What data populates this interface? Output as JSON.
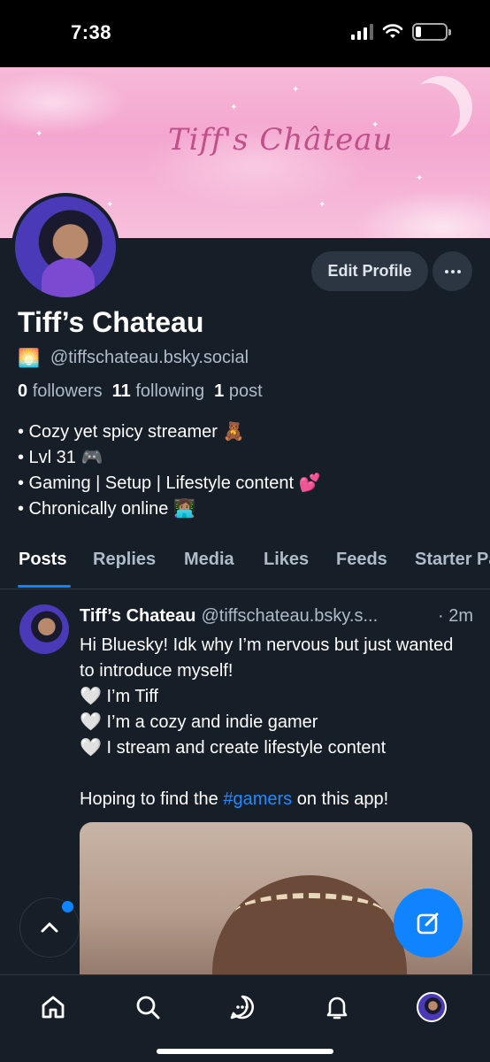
{
  "status_bar": {
    "time": "7:38"
  },
  "banner": {
    "title": "Tiff's Château"
  },
  "profile": {
    "edit_label": "Edit Profile",
    "display_name": "Tiff’s Chateau",
    "handle_emoji": "🌅",
    "handle": "@tiffschateau.bsky.social",
    "followers_count": "0",
    "followers_label": "followers",
    "following_count": "11",
    "following_label": "following",
    "posts_count": "1",
    "posts_label": "post",
    "bio": [
      "• Cozy yet spicy streamer 🧸",
      "• Lvl 31 🎮",
      "• Gaming | Setup | Lifestyle content 💕",
      "• Chronically online 👩🏽‍💻"
    ]
  },
  "tabs": [
    "Posts",
    "Replies",
    "Media",
    "Likes",
    "Feeds",
    "Starter Packs"
  ],
  "active_tab": "Posts",
  "post": {
    "author": "Tiff’s Chateau",
    "handle": "@tiffschateau.bsky.s...",
    "time": "· 2m",
    "lines": [
      "Hi Bluesky! Idk why I’m nervous but just wanted to introduce myself!",
      "🤍 I’m Tiff",
      "🤍 I’m a cozy and indie gamer",
      "🤍 I stream and create lifestyle content"
    ],
    "closing_before": "Hoping to find the ",
    "hashtag": "#gamers",
    "closing_after": " on this app!"
  },
  "nav": [
    "home-icon",
    "search-icon",
    "chat-icon",
    "bell-icon",
    "profile-avatar"
  ],
  "colors": {
    "accent": "#1083fe",
    "background": "#161e27",
    "surface": "#2b3642",
    "muted": "#aebbc9"
  }
}
